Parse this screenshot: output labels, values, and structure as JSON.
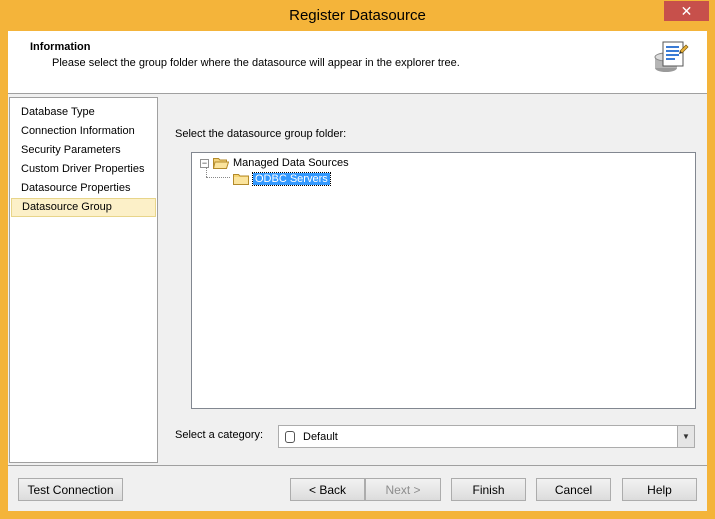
{
  "window": {
    "title": "Register Datasource",
    "close_label": "✕"
  },
  "info": {
    "title": "Information",
    "description": "Please select the group folder where the datasource will appear in the explorer tree."
  },
  "nav": {
    "items": [
      {
        "label": "Database Type"
      },
      {
        "label": "Connection Information"
      },
      {
        "label": "Security Parameters"
      },
      {
        "label": "Custom Driver Properties"
      },
      {
        "label": "Datasource Properties"
      },
      {
        "label": "Datasource Group",
        "selected": true
      }
    ]
  },
  "main": {
    "prompt": "Select the datasource group folder:",
    "tree": {
      "root": {
        "label": "Managed Data Sources",
        "expander": "−"
      },
      "child": {
        "label": "ODBC Servers",
        "selected": true
      }
    },
    "category": {
      "label": "Select a category:",
      "value": "Default"
    }
  },
  "buttons": {
    "test_connection": "Test Connection",
    "back": "< Back",
    "next": "Next >",
    "finish": "Finish",
    "cancel": "Cancel",
    "help": "Help"
  },
  "colors": {
    "frame": "#f4b43a",
    "selection": "#3399ff",
    "nav_selected": "#fcf0c8"
  }
}
